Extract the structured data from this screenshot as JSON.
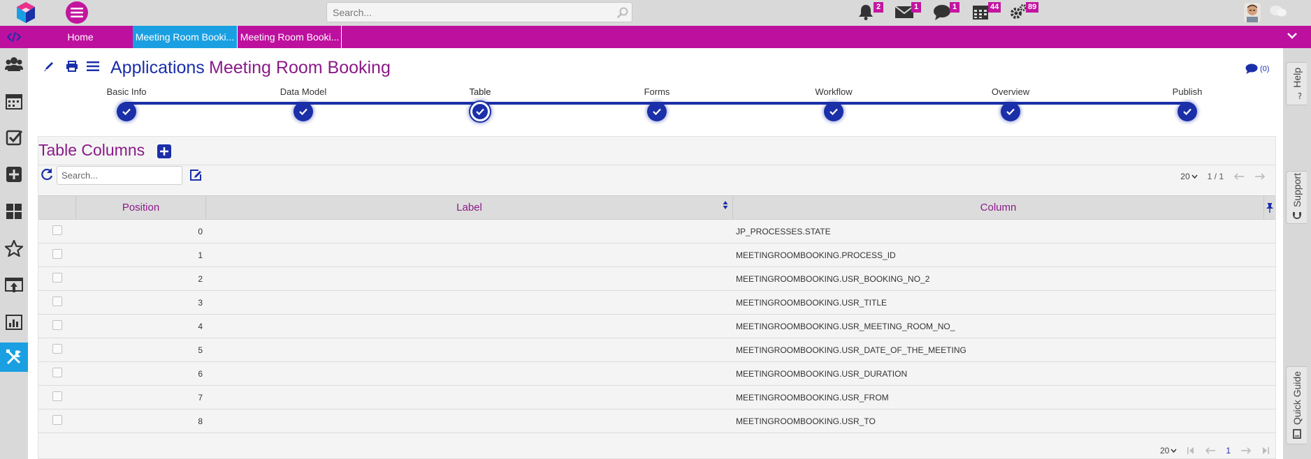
{
  "topbar": {
    "search_placeholder": "Search...",
    "notifications": [
      {
        "icon": "bell-icon",
        "count": "2"
      },
      {
        "icon": "mail-icon",
        "count": "1"
      },
      {
        "icon": "chat-icon",
        "count": "1"
      },
      {
        "icon": "calendar-icon",
        "count": "44"
      },
      {
        "icon": "gears-icon",
        "count": "89"
      }
    ]
  },
  "tabs": {
    "home": "Home",
    "tab1": "Meeting Room Booki...",
    "tab2": "Meeting Room Booki..."
  },
  "header": {
    "app_title": "Applications",
    "page_title": "Meeting Room Booking",
    "comments": "(0)"
  },
  "steps": [
    {
      "label": "Basic Info"
    },
    {
      "label": "Data Model"
    },
    {
      "label": "Table"
    },
    {
      "label": "Forms"
    },
    {
      "label": "Workflow"
    },
    {
      "label": "Overview"
    },
    {
      "label": "Publish"
    }
  ],
  "panel": {
    "title": "Table Columns",
    "search_placeholder": "Search...",
    "page_size": "20",
    "page_info": "1 / 1",
    "bottom_page": "1"
  },
  "table": {
    "headers": {
      "position": "Position",
      "label": "Label",
      "column": "Column"
    },
    "rows": [
      {
        "position": "0",
        "label": "",
        "column": "JP_PROCESSES.STATE"
      },
      {
        "position": "1",
        "label": "",
        "column": "MEETINGROOMBOOKING.PROCESS_ID"
      },
      {
        "position": "2",
        "label": "",
        "column": "MEETINGROOMBOOKING.USR_BOOKING_NO_2"
      },
      {
        "position": "3",
        "label": "",
        "column": "MEETINGROOMBOOKING.USR_TITLE"
      },
      {
        "position": "4",
        "label": "",
        "column": "MEETINGROOMBOOKING.USR_MEETING_ROOM_NO_"
      },
      {
        "position": "5",
        "label": "",
        "column": "MEETINGROOMBOOKING.USR_DATE_OF_THE_MEETING"
      },
      {
        "position": "6",
        "label": "",
        "column": "MEETINGROOMBOOKING.USR_DURATION"
      },
      {
        "position": "7",
        "label": "",
        "column": "MEETINGROOMBOOKING.USR_FROM"
      },
      {
        "position": "8",
        "label": "",
        "column": "MEETINGROOMBOOKING.USR_TO"
      }
    ]
  },
  "rail": {
    "help": "Help",
    "support": "Support",
    "quick_guide": "Quick Guide"
  },
  "colors": {
    "brand_magenta": "#be109e",
    "primary_blue": "#1b2fa8",
    "active_tab": "#1aa0e2",
    "title_purple": "#8a1b87"
  }
}
